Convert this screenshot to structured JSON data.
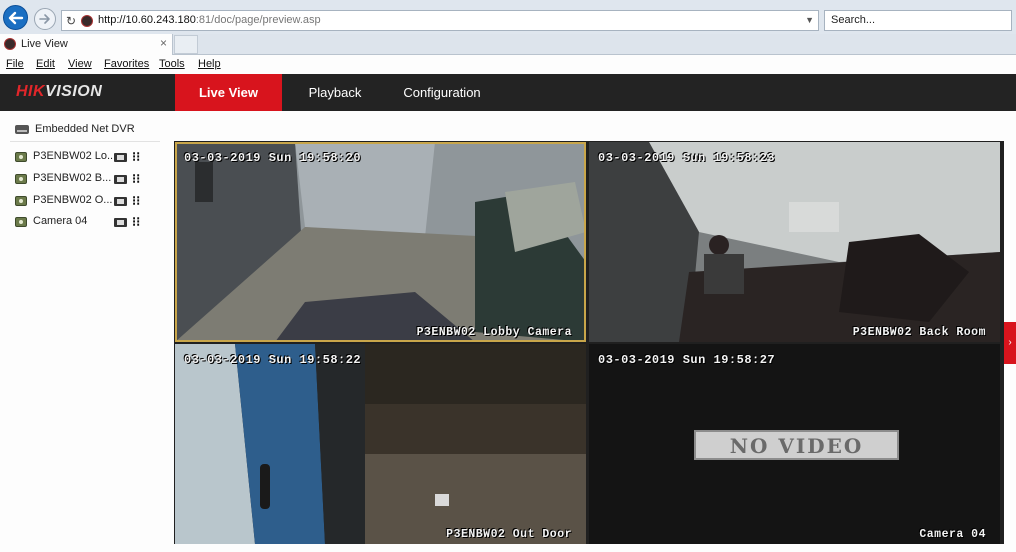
{
  "browser": {
    "url_host": "http://10.60.243.180",
    "url_rest": ":81/doc/page/preview.asp",
    "search_placeholder": "Search...",
    "tab_title": "Live View",
    "tab_close": "×",
    "menu": [
      "File",
      "Edit",
      "View",
      "Favorites",
      "Tools",
      "Help"
    ]
  },
  "app": {
    "logo_part1": "HIK",
    "logo_part2": "VISION",
    "nav": [
      "Live View",
      "Playback",
      "Configuration"
    ],
    "active_nav": "Live View",
    "accent_color": "#d8141d"
  },
  "sidebar": {
    "device": "Embedded Net DVR",
    "cameras": [
      "P3ENBW02 Lo...",
      "P3ENBW02 B...",
      "P3ENBW02 O...",
      "Camera 04"
    ]
  },
  "tiles": [
    {
      "timestamp": "03-03-2019 Sun 19:58:20",
      "caption": "P3ENBW02 Lobby Camera",
      "selected": true
    },
    {
      "timestamp": "03-03-2019 Sun 19:58:23",
      "caption": "P3ENBW02 Back Room",
      "selected": false
    },
    {
      "timestamp": "03-03-2019 Sun 19:58:22",
      "caption": "P3ENBW02 Out Door",
      "selected": false
    },
    {
      "timestamp": "03-03-2019 Sun 19:58:27",
      "caption": "Camera 04",
      "no_video": "NO VIDEO",
      "selected": false
    }
  ]
}
